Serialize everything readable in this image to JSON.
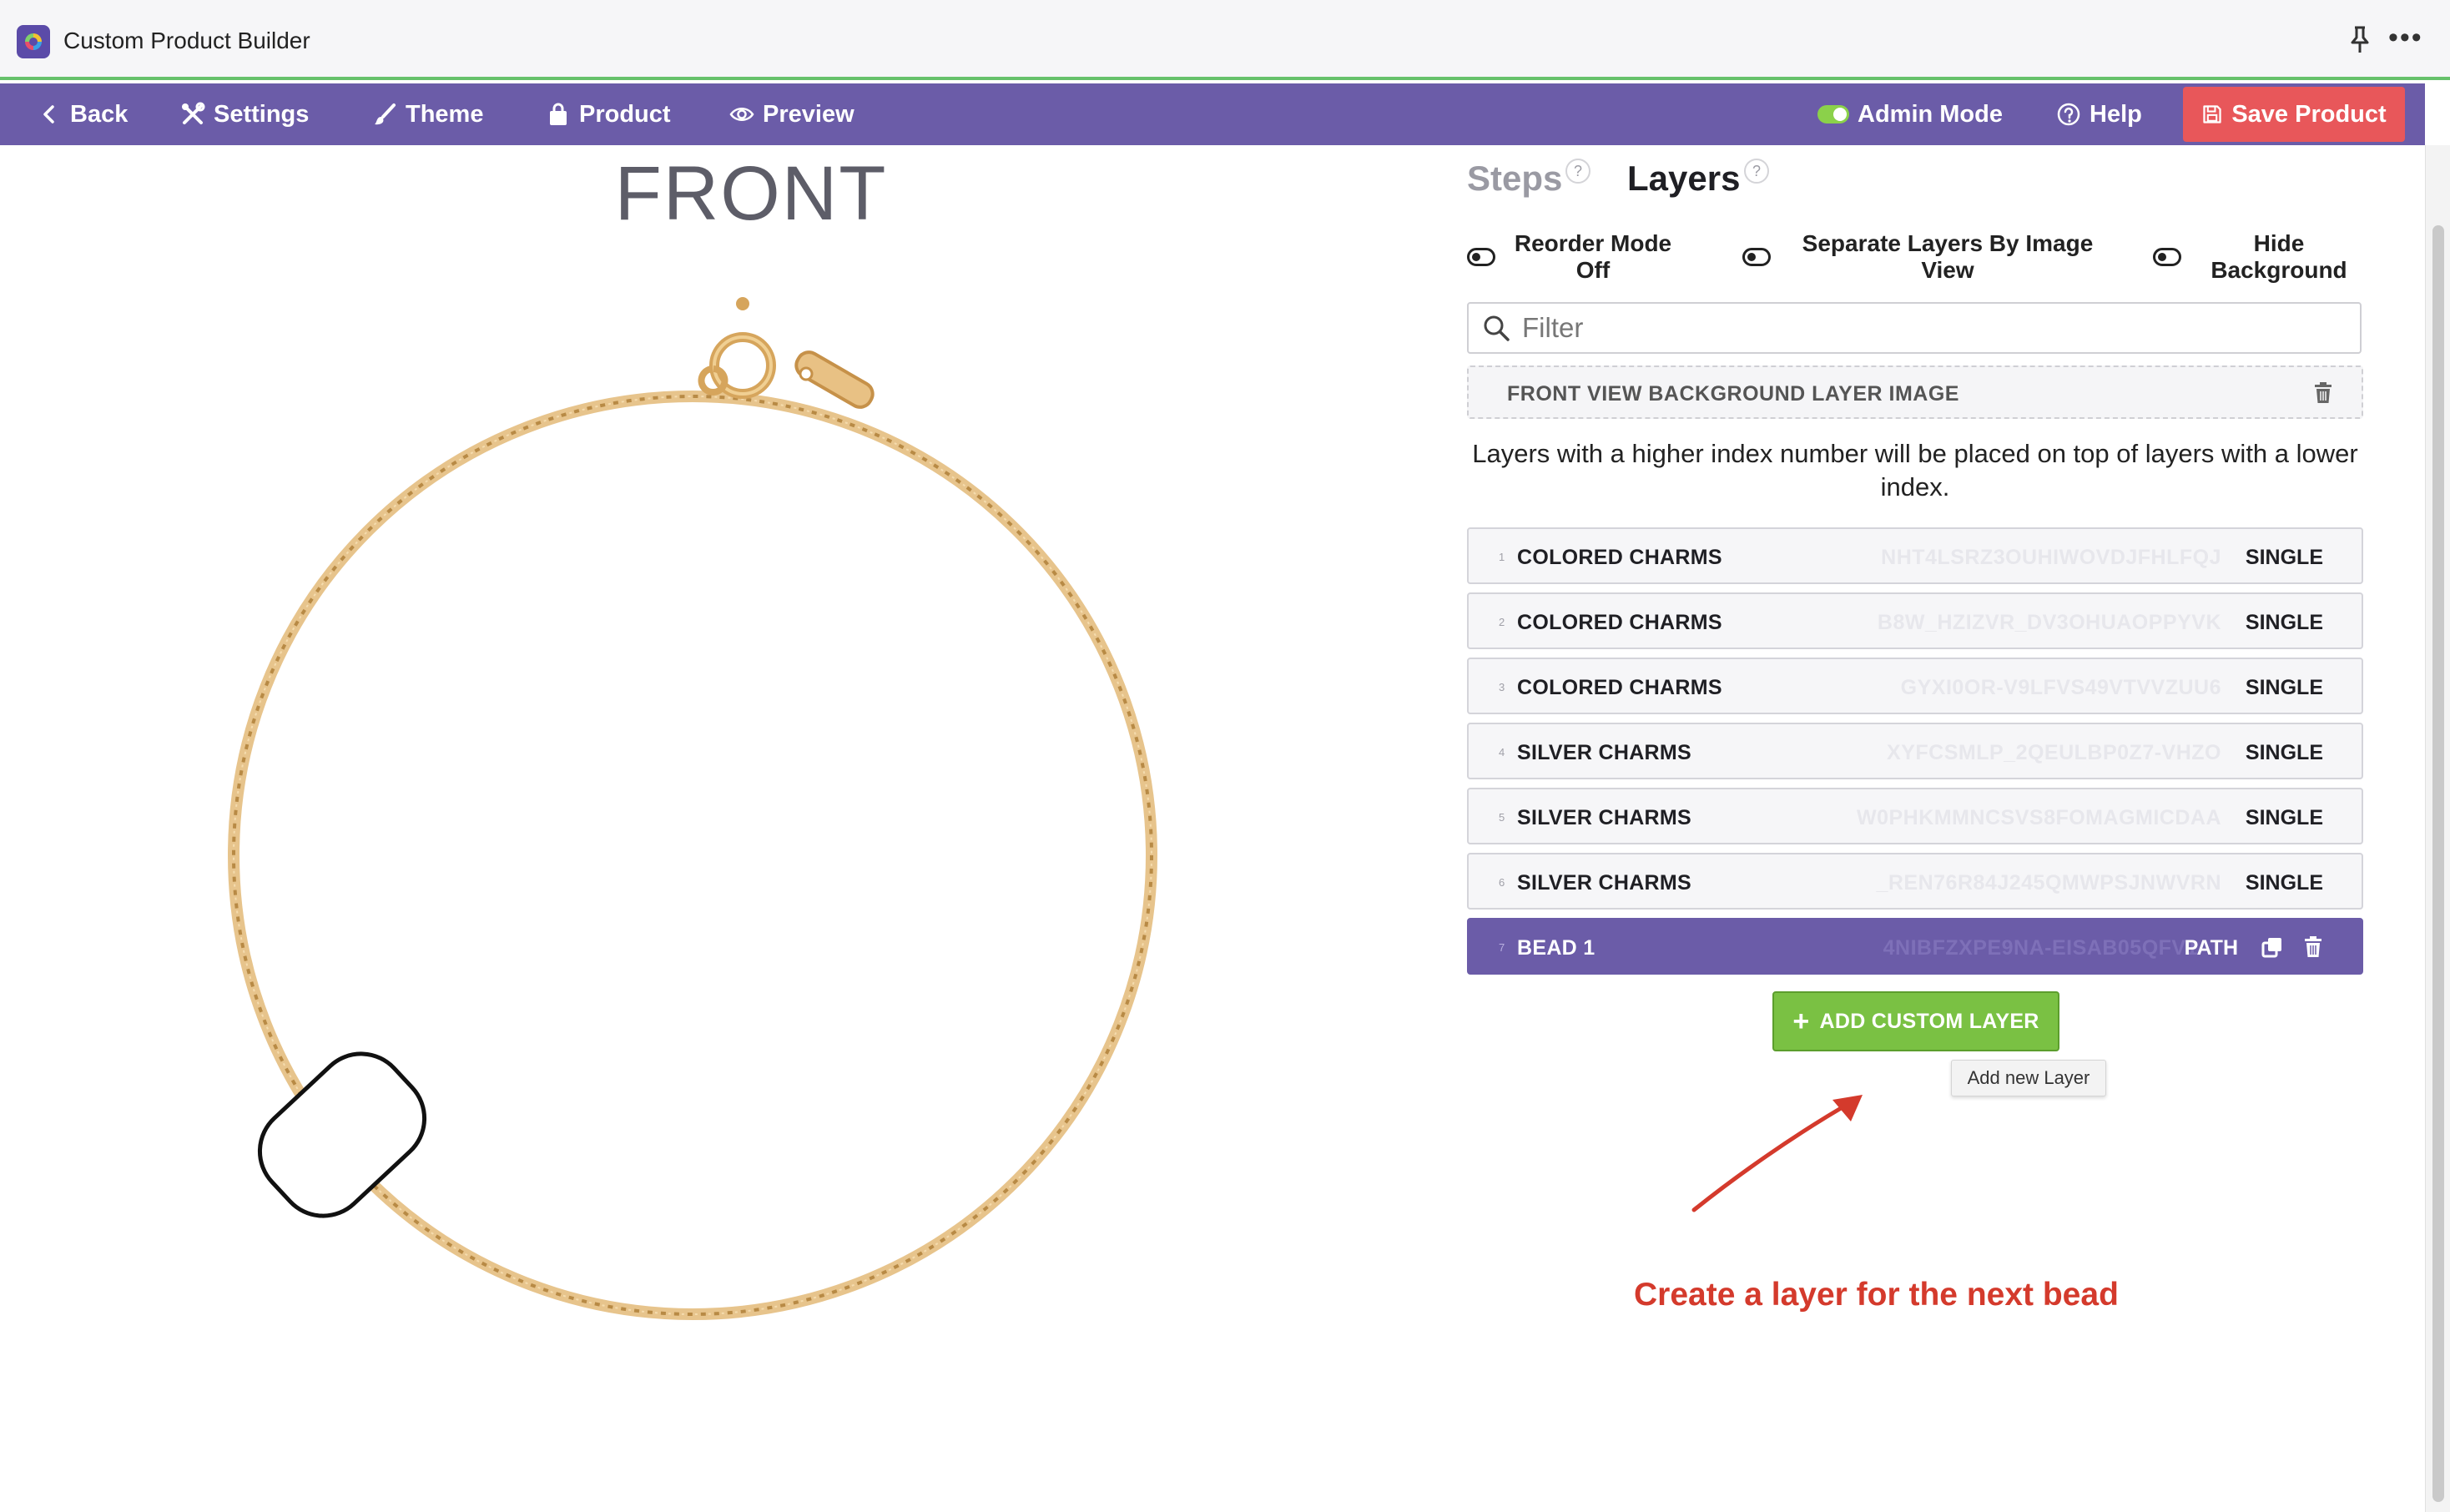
{
  "window": {
    "title": "Custom Product Builder"
  },
  "toolbar": {
    "back": "Back",
    "settings": "Settings",
    "theme": "Theme",
    "product": "Product",
    "preview": "Preview",
    "admin_mode": "Admin Mode",
    "help": "Help",
    "save": "Save Product"
  },
  "canvas": {
    "view_label": "FRONT"
  },
  "panel": {
    "tabs": [
      {
        "label": "Steps",
        "active": false
      },
      {
        "label": "Layers",
        "active": true
      }
    ],
    "help_mark": "?",
    "options": {
      "reorder_mode": "Reorder Mode Off",
      "separate_layers": "Separate Layers By Image View",
      "hide_background": "Hide Background"
    },
    "filter_placeholder": "Filter",
    "background_layer": "FRONT VIEW BACKGROUND LAYER IMAGE",
    "hint": "Layers with a higher index number will be placed on top of layers with a lower index.",
    "layers": [
      {
        "index": "1",
        "name": "COLORED CHARMS",
        "code": "NHT4LSRZ3OUHIWOVDJFHLFQJ",
        "type": "SINGLE"
      },
      {
        "index": "2",
        "name": "COLORED CHARMS",
        "code": "B8W_HZIZVR_DV3OHUAOPPYVK",
        "type": "SINGLE"
      },
      {
        "index": "3",
        "name": "COLORED CHARMS",
        "code": "GYXI0OR-V9LFVS49VTVVZUU6",
        "type": "SINGLE"
      },
      {
        "index": "4",
        "name": "SILVER CHARMS",
        "code": "XYFCSMLP_2QEULBP0Z7-VHZO",
        "type": "SINGLE"
      },
      {
        "index": "5",
        "name": "SILVER CHARMS",
        "code": "W0PHKMMNCSVS8FOMAGMICDAA",
        "type": "SINGLE"
      },
      {
        "index": "6",
        "name": "SILVER CHARMS",
        "code": "_REN76R84J245QMWPSJNWVRN",
        "type": "SINGLE"
      },
      {
        "index": "7",
        "name": "BEAD 1",
        "code": "4NIBFZXPE9NA-EISAB05QFV1",
        "type": "PATH",
        "selected": true
      }
    ],
    "add_layer": "ADD CUSTOM LAYER",
    "add_layer_tooltip": "Add new Layer"
  },
  "annotation": {
    "text": "Create a layer for the next bead",
    "color": "#d43a2c"
  },
  "colors": {
    "toolbar": "#6b5ca8",
    "save": "#e8575a",
    "add_layer": "#7ac143",
    "chain": "#d9ad6a"
  },
  "icons": {
    "back": "chevron-left-icon",
    "settings": "tools-icon",
    "theme": "brush-icon",
    "product": "bag-icon",
    "preview": "eye-icon",
    "help": "question-circle-icon",
    "save": "save-icon",
    "filter": "search-icon",
    "delete": "trash-icon",
    "duplicate": "copy-icon"
  }
}
